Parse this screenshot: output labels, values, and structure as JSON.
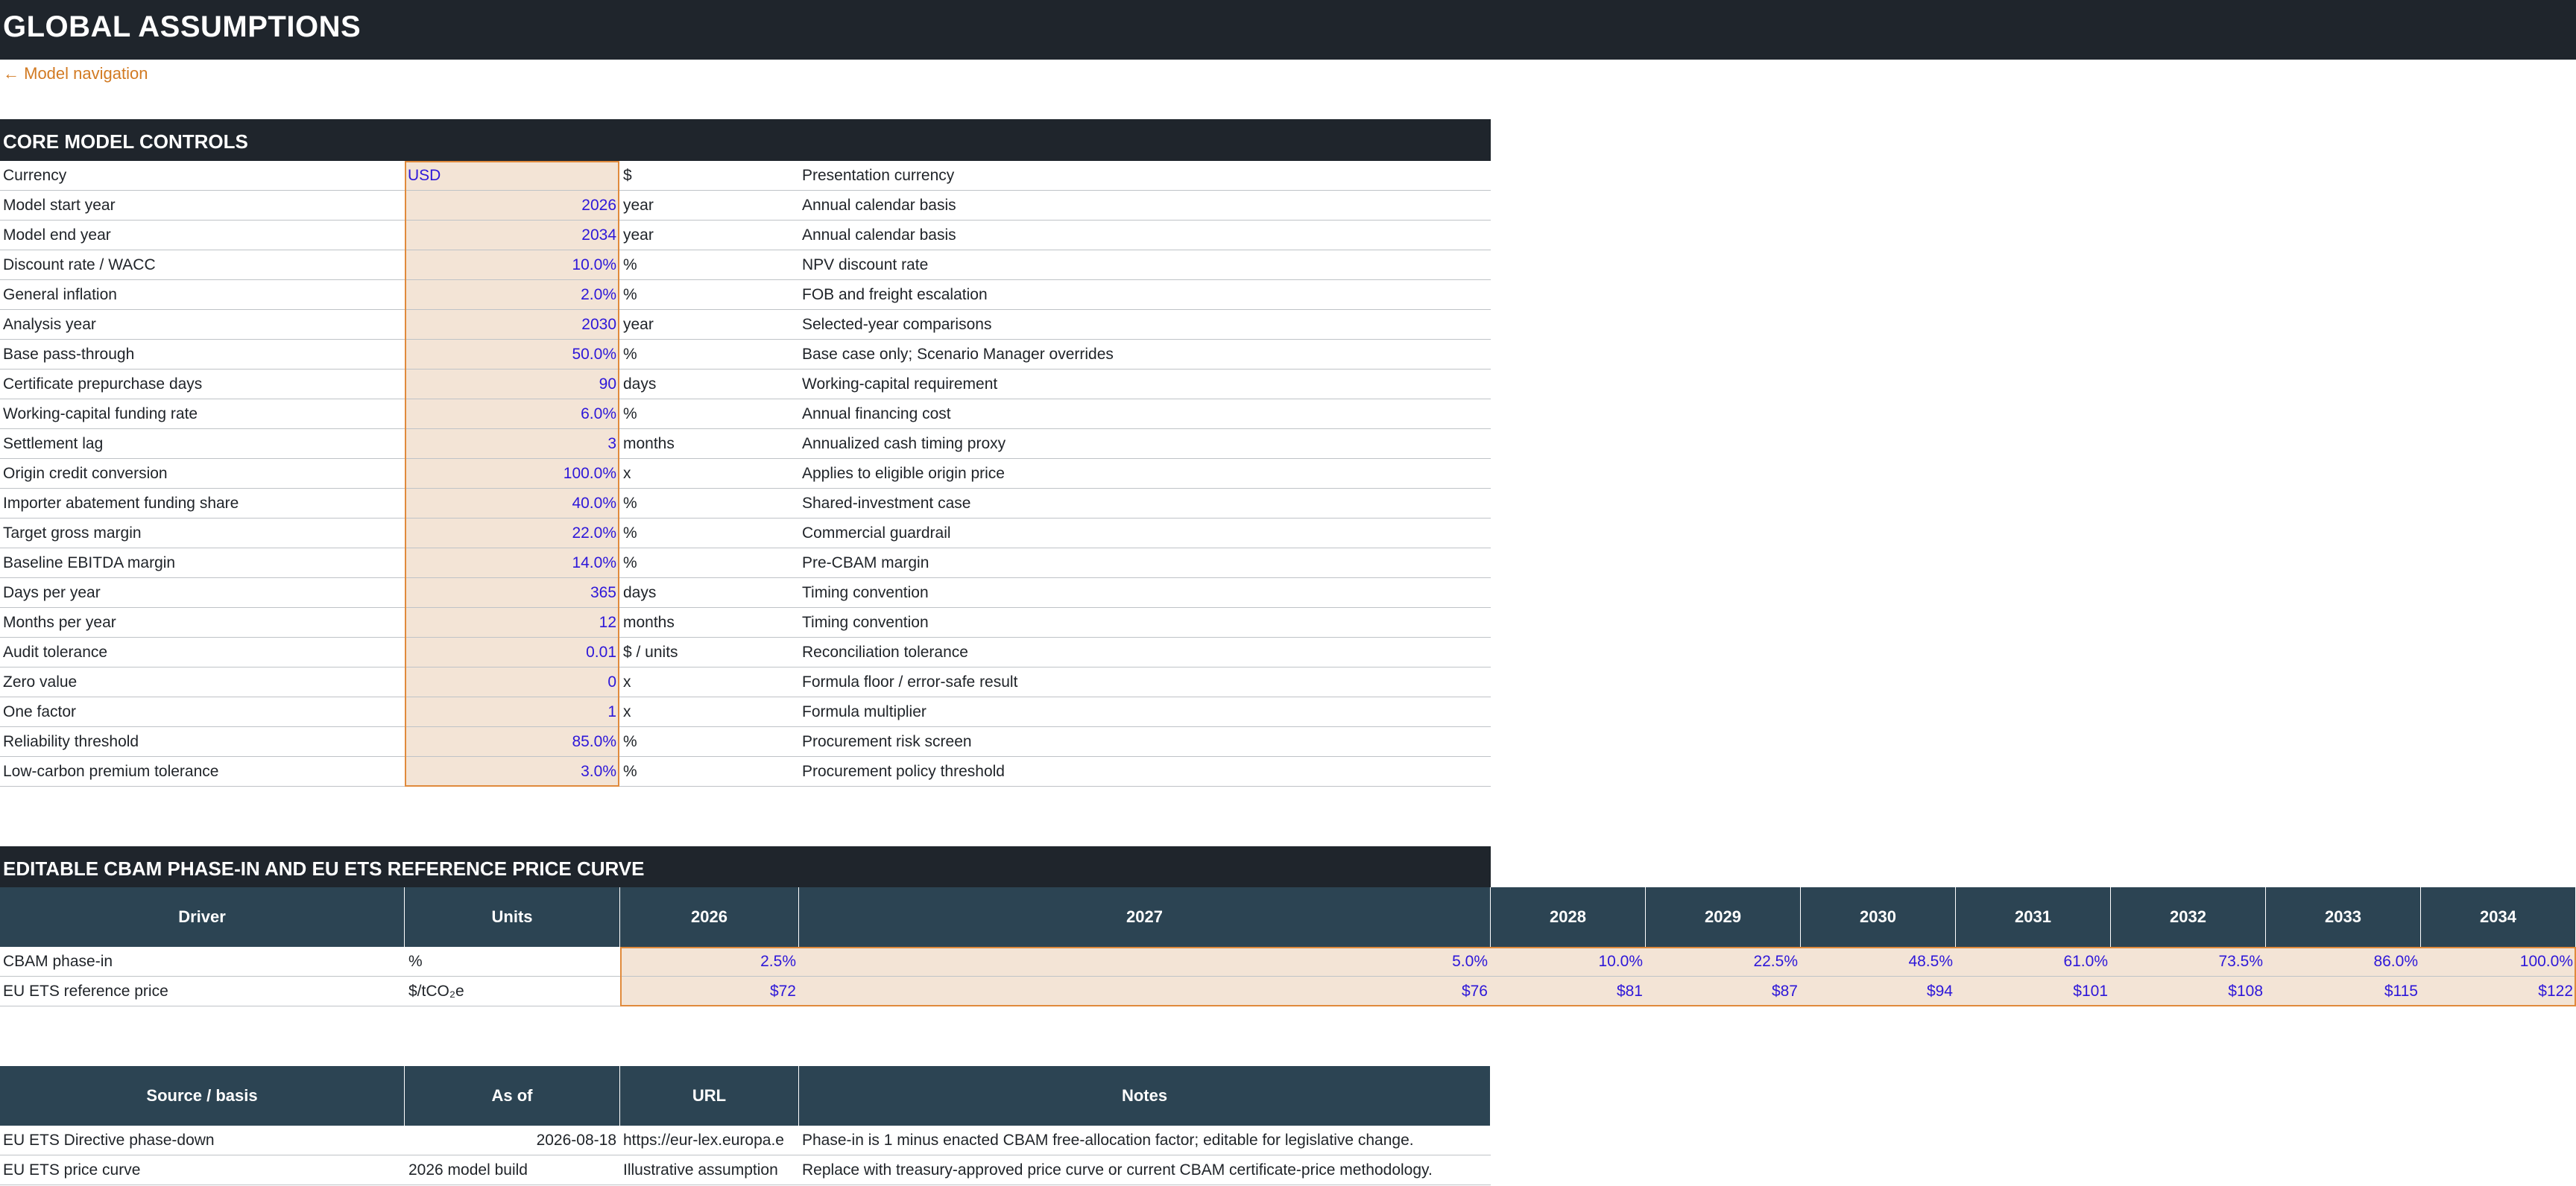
{
  "title": "GLOBAL ASSUMPTIONS",
  "nav_link": "← Model navigation",
  "core": {
    "heading": "CORE MODEL CONTROLS",
    "rows": [
      {
        "label": "Currency",
        "value": "USD",
        "unit": "$",
        "note": "Presentation currency"
      },
      {
        "label": "Model start year",
        "value": "2026",
        "unit": "year",
        "note": "Annual calendar basis"
      },
      {
        "label": "Model end year",
        "value": "2034",
        "unit": "year",
        "note": "Annual calendar basis"
      },
      {
        "label": "Discount rate / WACC",
        "value": "10.0%",
        "unit": "%",
        "note": "NPV discount rate"
      },
      {
        "label": "General inflation",
        "value": "2.0%",
        "unit": "%",
        "note": "FOB and freight escalation"
      },
      {
        "label": "Analysis year",
        "value": "2030",
        "unit": "year",
        "note": "Selected-year comparisons"
      },
      {
        "label": "Base pass-through",
        "value": "50.0%",
        "unit": "%",
        "note": "Base case only; Scenario Manager overrides"
      },
      {
        "label": "Certificate prepurchase days",
        "value": "90",
        "unit": "days",
        "note": "Working-capital requirement"
      },
      {
        "label": "Working-capital funding rate",
        "value": "6.0%",
        "unit": "%",
        "note": "Annual financing cost"
      },
      {
        "label": "Settlement lag",
        "value": "3",
        "unit": "months",
        "note": "Annualized cash timing proxy"
      },
      {
        "label": "Origin credit conversion",
        "value": "100.0%",
        "unit": "x",
        "note": "Applies to eligible origin price"
      },
      {
        "label": "Importer abatement funding share",
        "value": "40.0%",
        "unit": "%",
        "note": "Shared-investment case"
      },
      {
        "label": "Target gross margin",
        "value": "22.0%",
        "unit": "%",
        "note": "Commercial guardrail"
      },
      {
        "label": "Baseline EBITDA margin",
        "value": "14.0%",
        "unit": "%",
        "note": "Pre-CBAM margin"
      },
      {
        "label": "Days per year",
        "value": "365",
        "unit": "days",
        "note": "Timing convention"
      },
      {
        "label": "Months per year",
        "value": "12",
        "unit": "months",
        "note": "Timing convention"
      },
      {
        "label": "Audit tolerance",
        "value": "0.01",
        "unit": "$ / units",
        "note": "Reconciliation tolerance"
      },
      {
        "label": "Zero value",
        "value": "0",
        "unit": "x",
        "note": "Formula floor / error-safe result"
      },
      {
        "label": "One factor",
        "value": "1",
        "unit": "x",
        "note": "Formula multiplier"
      },
      {
        "label": "Reliability threshold",
        "value": "85.0%",
        "unit": "%",
        "note": "Procurement risk screen"
      },
      {
        "label": "Low-carbon premium tolerance",
        "value": "3.0%",
        "unit": "%",
        "note": "Procurement policy threshold"
      }
    ]
  },
  "phase": {
    "heading": "EDITABLE CBAM PHASE-IN AND EU ETS REFERENCE PRICE CURVE",
    "headers": {
      "driver": "Driver",
      "units": "Units"
    },
    "years": [
      "2026",
      "2027",
      "2028",
      "2029",
      "2030",
      "2031",
      "2032",
      "2033",
      "2034"
    ],
    "rows": [
      {
        "label": "CBAM phase-in",
        "units": "%",
        "values": [
          "2.5%",
          "5.0%",
          "10.0%",
          "22.5%",
          "48.5%",
          "61.0%",
          "73.5%",
          "86.0%",
          "100.0%"
        ]
      },
      {
        "label": "EU ETS reference price",
        "units": "$/tCO₂e",
        "values": [
          "$72",
          "$76",
          "$81",
          "$87",
          "$94",
          "$101",
          "$108",
          "$115",
          "$122"
        ]
      }
    ]
  },
  "sources": {
    "headers": {
      "source": "Source / basis",
      "asof": "As of",
      "url": "URL",
      "notes": "Notes"
    },
    "rows": [
      {
        "source": "EU ETS Directive phase-down",
        "asof": "2026-08-18",
        "url": "https://eur-lex.europa.e",
        "notes": "Phase-in is 1 minus enacted CBAM free-allocation factor; editable for legislative change."
      },
      {
        "source": "EU ETS price curve",
        "asof": "2026 model build",
        "url": "Illustrative assumption",
        "notes": "Replace with treasury-approved price curve or current CBAM certificate-price methodology."
      }
    ]
  }
}
